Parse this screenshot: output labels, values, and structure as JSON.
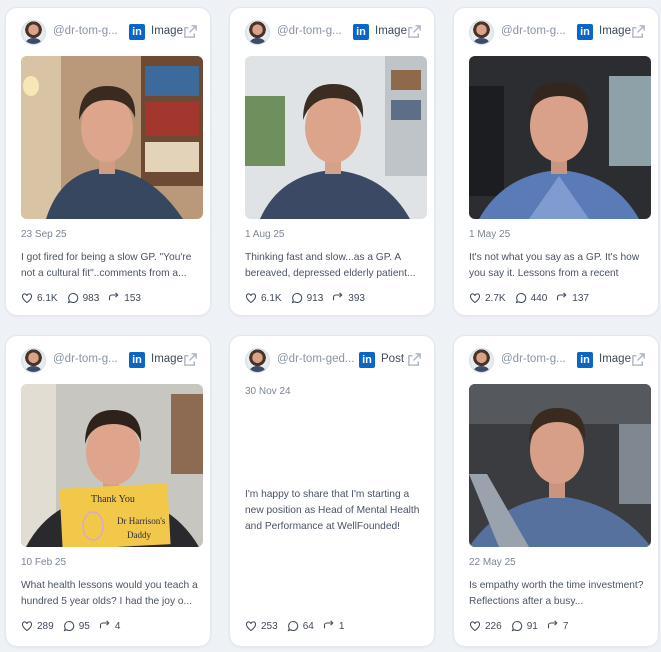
{
  "cards": [
    {
      "handle": "@dr-tom-g...",
      "type": "Image",
      "date": "23 Sep 25",
      "text": "I got fired for being a slow GP. \"You're not a cultural fit\"..comments from a...",
      "likes": "6.1K",
      "comments": "983",
      "reposts": "153"
    },
    {
      "handle": "@dr-tom-g...",
      "type": "Image",
      "date": "1 Aug 25",
      "text": "Thinking fast and slow...as a GP. A bereaved, depressed elderly patient...",
      "likes": "6.1K",
      "comments": "913",
      "reposts": "393"
    },
    {
      "handle": "@dr-tom-g...",
      "type": "Image",
      "date": "1 May 25",
      "text": "It's not what you say as a GP. It's how you say it. Lessons from a recent near...",
      "likes": "2.7K",
      "comments": "440",
      "reposts": "137"
    },
    {
      "handle": "@dr-tom-g...",
      "type": "Image",
      "date": "10 Feb 25",
      "text": "What health lessons would you teach a hundred 5 year olds? I had the joy o...",
      "likes": "289",
      "comments": "95",
      "reposts": "4",
      "card_text": [
        "Thank You",
        "Dr Harrison's",
        "Daddy"
      ]
    },
    {
      "handle": "@dr-tom-ged...",
      "type": "Post",
      "date": "30 Nov 24",
      "text": "I'm happy to share that I'm starting a new position as Head of Mental Health and Performance at WellFounded!",
      "likes": "253",
      "comments": "64",
      "reposts": "1"
    },
    {
      "handle": "@dr-tom-g...",
      "type": "Image",
      "date": "22 May 25",
      "text": "Is empathy worth the time investment? Reflections after a busy...",
      "likes": "226",
      "comments": "91",
      "reposts": "7"
    }
  ],
  "icons": {
    "linkedin": "linkedin-icon",
    "external": "external-link-icon",
    "like": "heart-icon",
    "comment": "comment-icon",
    "repost": "repost-icon"
  },
  "colors": {
    "linkedin_blue": "#0a66c2",
    "background": "#eef1f6"
  },
  "linkedin_glyph": "in"
}
